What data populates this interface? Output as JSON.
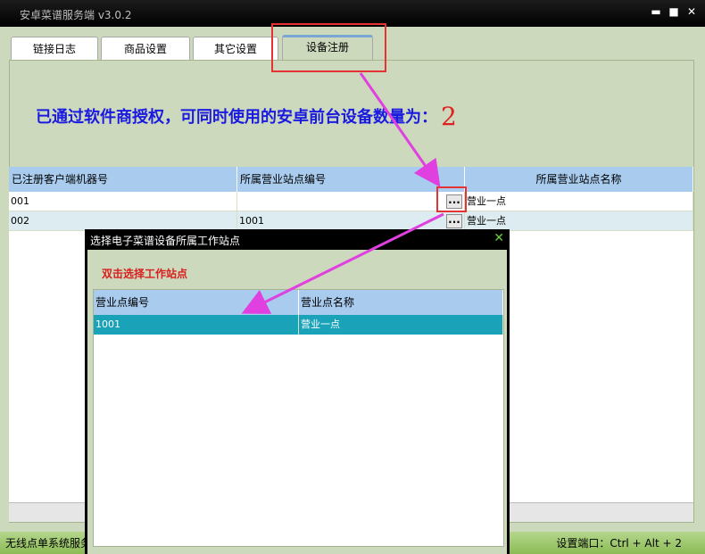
{
  "window": {
    "title": "安卓菜谱服务端 v3.0.2",
    "min_icon": "minimize-icon",
    "max_icon": "maximize-icon",
    "close_icon": "close-icon"
  },
  "tabs": [
    {
      "label": "链接日志",
      "active": false
    },
    {
      "label": "商品设置",
      "active": false
    },
    {
      "label": "其它设置",
      "active": false
    },
    {
      "label": "设备注册",
      "active": true
    }
  ],
  "banner": {
    "text": "已通过软件商授权，可同时使用的安卓前台设备数量为：",
    "count": "2"
  },
  "device_table": {
    "columns": [
      "已注册客户端机器号",
      "所属营业站点编号",
      "所属营业站点名称"
    ],
    "rows": [
      {
        "machine": "001",
        "site_code": "",
        "site_name": "营业一点"
      },
      {
        "machine": "002",
        "site_code": "1001",
        "site_name": "营业一点"
      }
    ],
    "ellipsis_label": "..."
  },
  "dialog": {
    "title": "选择电子菜谱设备所属工作站点",
    "hint": "双击选择工作站点",
    "columns": [
      "营业点编号",
      "营业点名称"
    ],
    "rows": [
      {
        "code": "1001",
        "name": "营业一点"
      }
    ]
  },
  "status": {
    "left": "无线点单系统服务",
    "right": "设置端口：Ctrl + Alt + 2"
  },
  "colors": {
    "frame_bg": "#cdd9bc",
    "header_bg": "#a8cbee",
    "selected_row": "#1aa3b8",
    "annotation_red": "#e53333",
    "arrow_magenta": "#e040e0"
  }
}
